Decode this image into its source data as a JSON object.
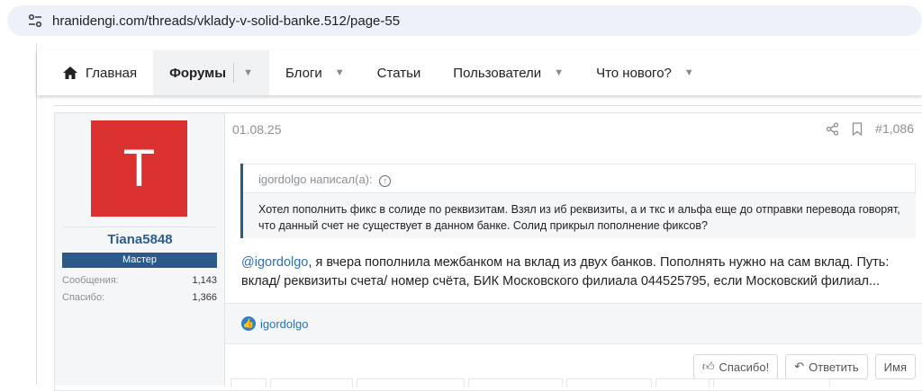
{
  "browser": {
    "url": "hranidengi.com/threads/vklady-v-solid-banke.512/page-55",
    "site_icon": "tune-icon"
  },
  "nav": {
    "home": "Главная",
    "forums": "Форумы",
    "blogs": "Блоги",
    "articles": "Статьи",
    "users": "Пользователи",
    "whats_new": "Что нового?",
    "caret": "▼"
  },
  "post": {
    "date": "01.08.25",
    "number": "#1,086",
    "user": {
      "avatar_letter": "T",
      "avatar_color": "#dc3131",
      "name": "Tiana5848",
      "rank": "Мастер",
      "messages_label": "Сообщения:",
      "messages_value": "1,143",
      "thanks_label": "Спасибо:",
      "thanks_value": "1,366"
    },
    "quote": {
      "header": "igordolgo написал(а):",
      "text": "Хотел пополнить фикс в солиде по реквизитам. Взял из иб реквизиты, а и ткс и альфа еще до отправки перевода говорят, что данный счет не существует в данном банке. Солид прикрыл пополнение фиксов?"
    },
    "mention": "@igordolgo",
    "body": ", я вчера пополнила межбанком на вклад из двух банков. Пополнять нужно на сам вклад. Путь: вклад/ реквизиты счета/ номер счёта, БИК Московского филиала 044525795, если Московский филиал...",
    "reaction_user": "igordolgo",
    "actions": {
      "thanks": "Спасибо!",
      "reply": "Ответить",
      "name": "Имя"
    }
  }
}
